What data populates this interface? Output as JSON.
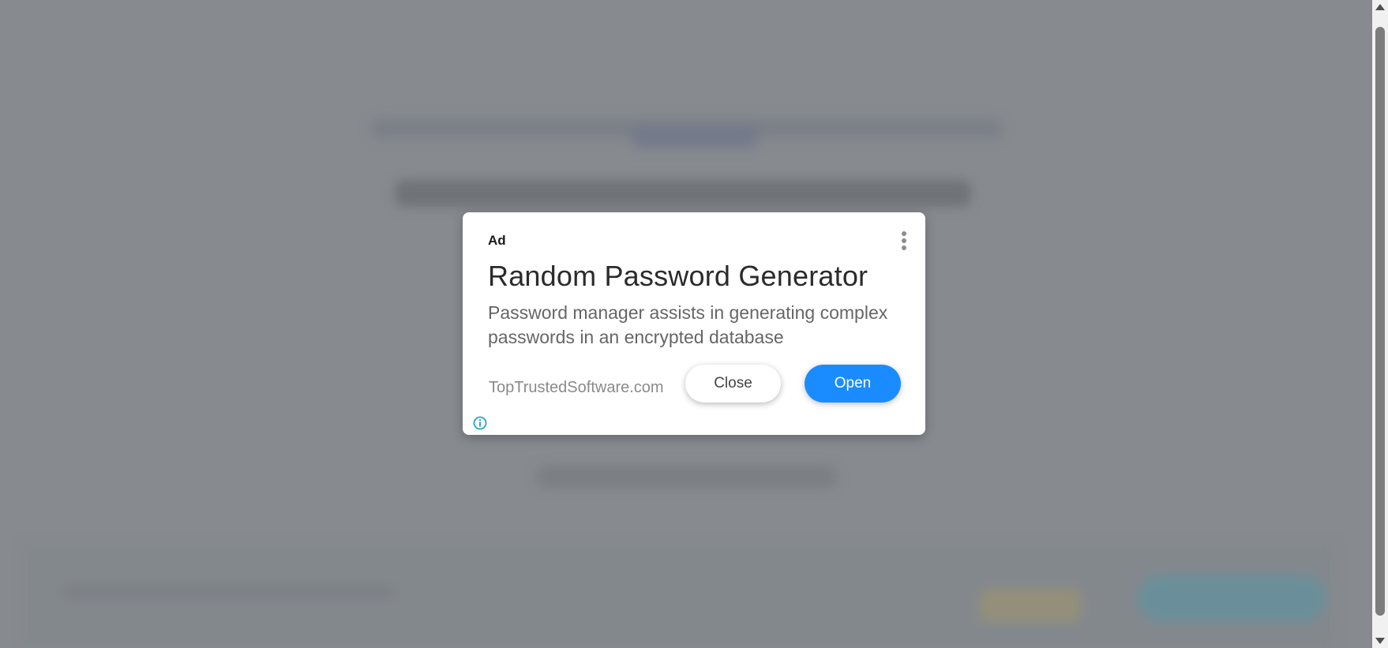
{
  "ad": {
    "label": "Ad",
    "title": "Random Password Generator",
    "description": "Password manager assists in generating complex passwords in an encrypted database",
    "domain": "TopTrustedSoftware.com",
    "close_label": "Close",
    "open_label": "Open",
    "menu_icon": "more-vertical-icon",
    "info_icon": "info-icon"
  },
  "colors": {
    "overlay": "#878b8f",
    "open_button": "#1a8cff",
    "info_icon": "#2aa5c8"
  }
}
